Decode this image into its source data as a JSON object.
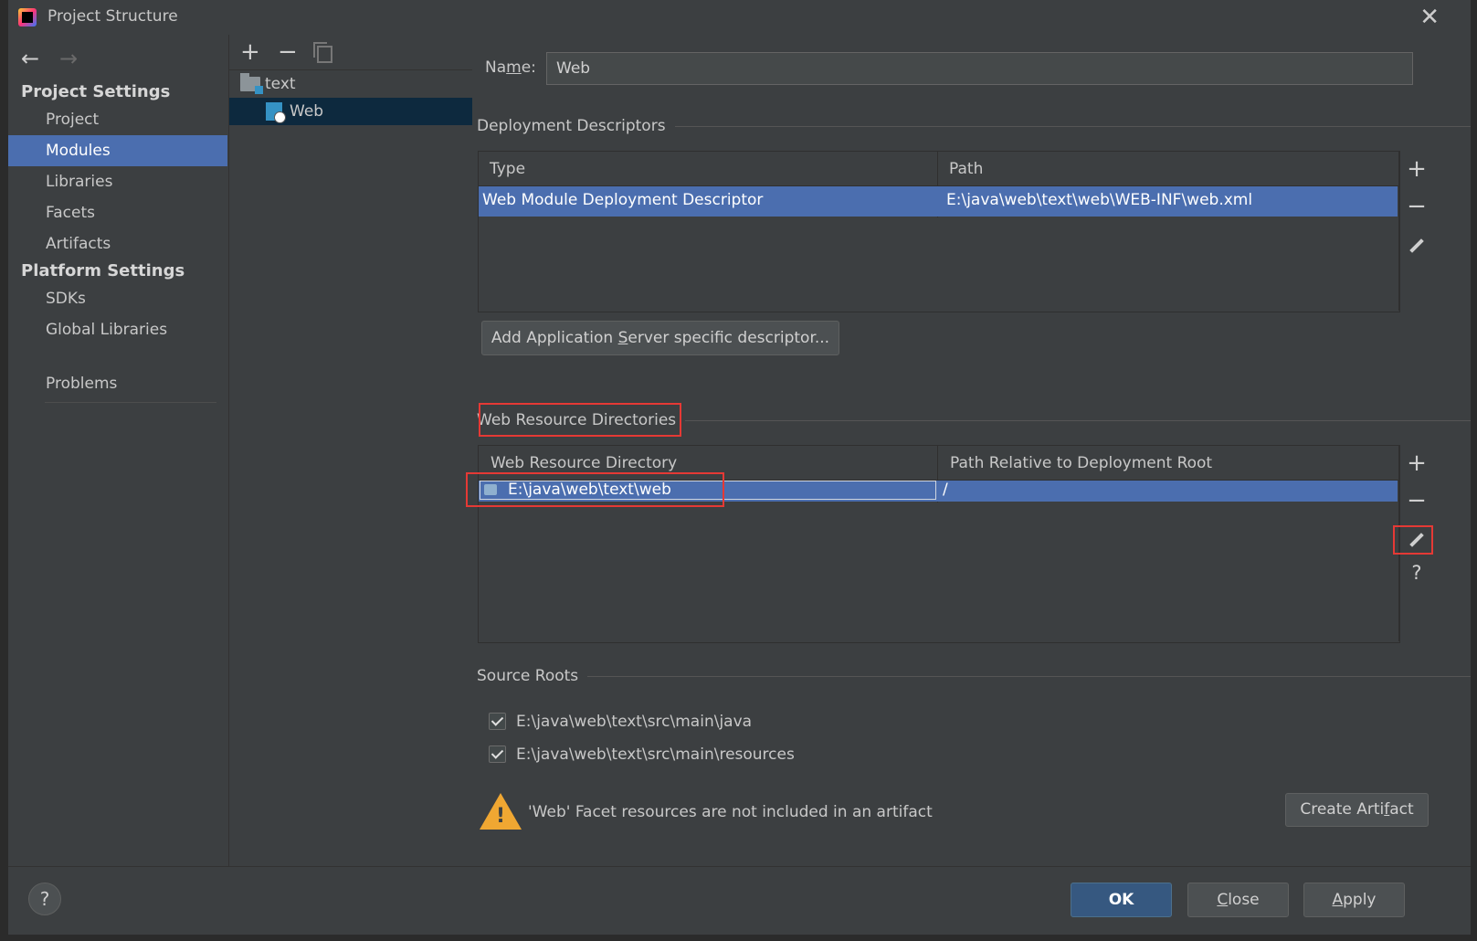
{
  "window": {
    "title": "Project Structure",
    "close_icon": "close-icon"
  },
  "sidebar": {
    "nav_back_icon": "arrow-left-icon",
    "nav_forward_icon": "arrow-right-icon",
    "project_settings_header": "Project Settings",
    "project_settings_items": [
      "Project",
      "Modules",
      "Libraries",
      "Facets",
      "Artifacts"
    ],
    "platform_settings_header": "Platform Settings",
    "platform_settings_items": [
      "SDKs",
      "Global Libraries"
    ],
    "problems": "Problems",
    "selected": "Modules"
  },
  "module_tree": {
    "toolbar": {
      "add": "+",
      "remove": "−"
    },
    "nodes": [
      {
        "label": "text",
        "icon": "module-folder-icon"
      },
      {
        "label": "Web",
        "icon": "web-facet-icon",
        "selected": true
      }
    ]
  },
  "facet": {
    "name_label": "Name:",
    "name_label_parts": {
      "pre": "Na",
      "mnemonic": "m",
      "post": "e:"
    },
    "name_value": "Web",
    "deployment": {
      "title": "Deployment Descriptors",
      "columns": [
        "Type",
        "Path"
      ],
      "rows": [
        {
          "type": "Web Module Deployment Descriptor",
          "path": "E:\\java\\web\\text\\web\\WEB-INF\\web.xml"
        }
      ],
      "add_server_button": {
        "label": "Add Application Server specific descriptor...",
        "pre": "Add Application ",
        "mnemonic": "S",
        "post": "erver specific descriptor..."
      }
    },
    "web_resources": {
      "title": "Web Resource Directories",
      "columns": [
        "Web Resource Directory",
        "Path Relative to Deployment Root"
      ],
      "rows": [
        {
          "directory": "E:\\java\\web\\text\\web",
          "relative_path": "/"
        }
      ]
    },
    "source_roots": {
      "title": "Source Roots",
      "items": [
        {
          "path": "E:\\java\\web\\text\\src\\main\\java",
          "checked": true
        },
        {
          "path": "E:\\java\\web\\text\\src\\main\\resources",
          "checked": true
        }
      ]
    },
    "warning": {
      "text": "'Web' Facet resources are not included in an artifact",
      "icon": "warning-icon",
      "create_button": "Create Artifact",
      "create_pre": "Create Arti",
      "create_mnemonic": "f",
      "create_post": "act"
    }
  },
  "footer": {
    "help": "?",
    "ok": "OK",
    "close": "Close",
    "close_pre": "",
    "close_mnemonic": "C",
    "close_post": "lose",
    "apply": "Apply",
    "apply_pre": "",
    "apply_mnemonic": "A",
    "apply_post": "pply"
  },
  "colors": {
    "selection": "#4b6eaf",
    "tree_selection": "#0d293e",
    "highlight_box": "#e53935",
    "warning": "#f0a732"
  }
}
